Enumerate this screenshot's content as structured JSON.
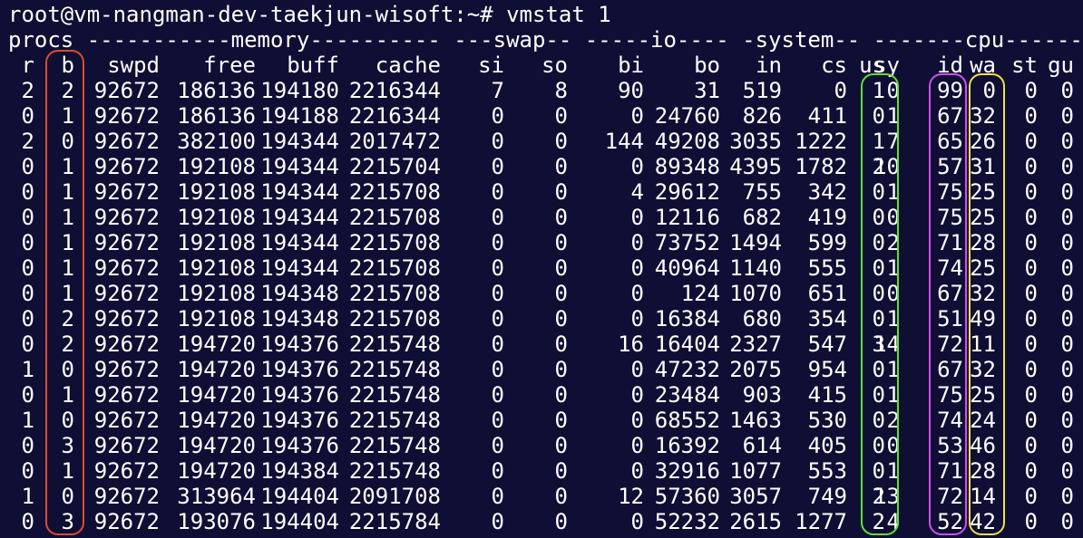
{
  "prompt": "root@vm-nangman-dev-taekjun-wisoft:~# vmstat 1",
  "group_header": "procs -----------memory---------- ---swap-- -----io---- -system-- -------cpu-------",
  "columns": [
    "r",
    "b",
    "swpd",
    "free",
    "buff",
    "cache",
    "si",
    "so",
    "bi",
    "bo",
    "in",
    "cs",
    "us",
    "sy",
    "id",
    "wa",
    "st",
    "gu"
  ],
  "rows": [
    [
      "2",
      "2",
      "92672",
      "186136",
      "194180",
      "2216344",
      "7",
      "8",
      "90",
      "31",
      "519",
      "0",
      "1",
      "0",
      "99",
      "0",
      "0",
      "0"
    ],
    [
      "0",
      "1",
      "92672",
      "186136",
      "194188",
      "2216344",
      "0",
      "0",
      "0",
      "24760",
      "826",
      "411",
      "0",
      "1",
      "67",
      "32",
      "0",
      "0"
    ],
    [
      "2",
      "0",
      "92672",
      "382100",
      "194344",
      "2017472",
      "0",
      "0",
      "144",
      "49208",
      "3035",
      "1222",
      "1",
      "7",
      "65",
      "26",
      "0",
      "0"
    ],
    [
      "0",
      "1",
      "92672",
      "192108",
      "194344",
      "2215704",
      "0",
      "0",
      "0",
      "89348",
      "4395",
      "1782",
      "2",
      "10",
      "57",
      "31",
      "0",
      "0"
    ],
    [
      "0",
      "1",
      "92672",
      "192108",
      "194344",
      "2215708",
      "0",
      "0",
      "4",
      "29612",
      "755",
      "342",
      "0",
      "1",
      "75",
      "25",
      "0",
      "0"
    ],
    [
      "0",
      "1",
      "92672",
      "192108",
      "194344",
      "2215708",
      "0",
      "0",
      "0",
      "12116",
      "682",
      "419",
      "0",
      "0",
      "75",
      "25",
      "0",
      "0"
    ],
    [
      "0",
      "1",
      "92672",
      "192108",
      "194344",
      "2215708",
      "0",
      "0",
      "0",
      "73752",
      "1494",
      "599",
      "0",
      "2",
      "71",
      "28",
      "0",
      "0"
    ],
    [
      "0",
      "1",
      "92672",
      "192108",
      "194344",
      "2215708",
      "0",
      "0",
      "0",
      "40964",
      "1140",
      "555",
      "0",
      "1",
      "74",
      "25",
      "0",
      "0"
    ],
    [
      "0",
      "1",
      "92672",
      "192108",
      "194348",
      "2215708",
      "0",
      "0",
      "0",
      "124",
      "1070",
      "651",
      "0",
      "0",
      "67",
      "32",
      "0",
      "0"
    ],
    [
      "0",
      "2",
      "92672",
      "192108",
      "194348",
      "2215708",
      "0",
      "0",
      "0",
      "16384",
      "680",
      "354",
      "0",
      "1",
      "51",
      "49",
      "0",
      "0"
    ],
    [
      "0",
      "2",
      "92672",
      "194720",
      "194376",
      "2215748",
      "0",
      "0",
      "16",
      "16404",
      "2327",
      "547",
      "3",
      "14",
      "72",
      "11",
      "0",
      "0"
    ],
    [
      "1",
      "0",
      "92672",
      "194720",
      "194376",
      "2215748",
      "0",
      "0",
      "0",
      "47232",
      "2075",
      "954",
      "0",
      "1",
      "67",
      "32",
      "0",
      "0"
    ],
    [
      "0",
      "1",
      "92672",
      "194720",
      "194376",
      "2215748",
      "0",
      "0",
      "0",
      "23484",
      "903",
      "415",
      "0",
      "1",
      "75",
      "25",
      "0",
      "0"
    ],
    [
      "1",
      "0",
      "92672",
      "194720",
      "194376",
      "2215748",
      "0",
      "0",
      "0",
      "68552",
      "1463",
      "530",
      "0",
      "2",
      "74",
      "24",
      "0",
      "0"
    ],
    [
      "0",
      "3",
      "92672",
      "194720",
      "194376",
      "2215748",
      "0",
      "0",
      "0",
      "16392",
      "614",
      "405",
      "0",
      "0",
      "53",
      "46",
      "0",
      "0"
    ],
    [
      "0",
      "1",
      "92672",
      "194720",
      "194384",
      "2215748",
      "0",
      "0",
      "0",
      "32916",
      "1077",
      "553",
      "0",
      "1",
      "71",
      "28",
      "0",
      "0"
    ],
    [
      "1",
      "0",
      "92672",
      "313964",
      "194404",
      "2091708",
      "0",
      "0",
      "12",
      "57360",
      "3057",
      "749",
      "2",
      "13",
      "72",
      "14",
      "0",
      "0"
    ],
    [
      "0",
      "3",
      "92672",
      "193076",
      "194404",
      "2215784",
      "0",
      "0",
      "0",
      "52232",
      "2615",
      "1277",
      "2",
      "4",
      "52",
      "42",
      "0",
      "0"
    ]
  ],
  "highlight_colors": {
    "b": "#e04a2e",
    "us": "#5ee034",
    "id": "#d04ef0",
    "wa": "#f2e04a"
  }
}
